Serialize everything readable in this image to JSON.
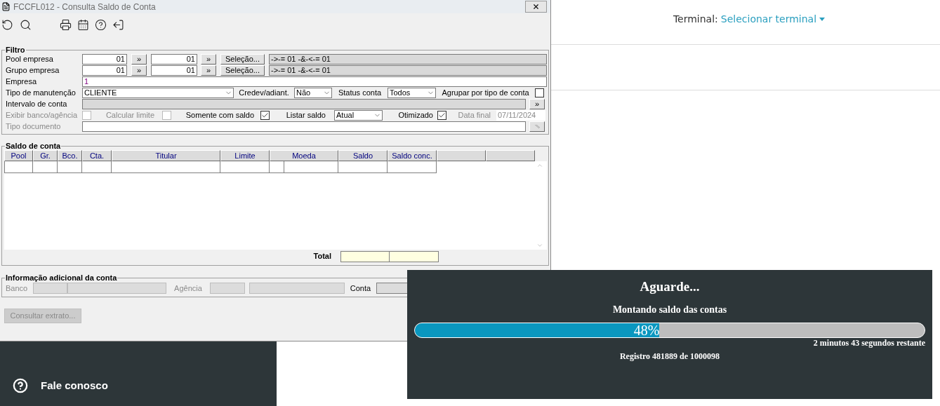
{
  "web_page": {
    "terminal_label": "Terminal:",
    "terminal_value": "Selecionar terminal",
    "sidebar": {
      "items": [
        {
          "label": "Fale conosco"
        }
      ]
    }
  },
  "window": {
    "title": "FCCFL012 - Consulta Saldo de Conta"
  },
  "filtro": {
    "title": "Filtro",
    "range_rows": [
      {
        "label": "Pool empresa",
        "from": "01",
        "from_button": "»",
        "to": "01",
        "to_button": "»",
        "selection_button": "Seleção...",
        "expression": "->-= 01 -&-<-= 01"
      },
      {
        "label": "Grupo empresa",
        "from": "01",
        "from_button": "»",
        "to": "01",
        "to_button": "»",
        "selection_button": "Seleção...",
        "expression": "->-= 01 -&-<-= 01"
      }
    ],
    "empresa": {
      "label": "Empresa",
      "value": "1"
    },
    "tipo_manutencao": {
      "label": "Tipo de manutenção",
      "value": "CLIENTE"
    },
    "credev": {
      "label": "Credev/adiant.",
      "value": "Não"
    },
    "status_conta": {
      "label": "Status conta",
      "value": "Todos"
    },
    "agrupar": {
      "label": "Agrupar por tipo de conta",
      "checked": false
    },
    "intervalo": {
      "label": "Intervalo de conta",
      "button": "»"
    },
    "options": [
      {
        "kind": "checkbox",
        "label": "Exibir banco/agência",
        "checked": false,
        "disabled": true
      },
      {
        "kind": "checkbox",
        "label": "Calcular limite",
        "checked": false,
        "disabled": true
      },
      {
        "kind": "checkbox",
        "label": "Somente com saldo",
        "checked": true,
        "disabled": false
      },
      {
        "kind": "select",
        "label": "Listar saldo",
        "value": "Atual",
        "disabled": false
      },
      {
        "kind": "checkbox",
        "label": "Otimizado",
        "checked": true,
        "disabled": false
      },
      {
        "kind": "date",
        "label": "Data final",
        "value": "07/11/2024",
        "disabled": true
      }
    ],
    "tipo_documento": {
      "label": "Tipo documento",
      "disabled": true
    }
  },
  "saldo": {
    "title": "Saldo de conta",
    "table": {
      "columns": [
        "Pool",
        "Gr.",
        "Bco.",
        "Cta.",
        "Titular",
        "Limite",
        "Moeda",
        "Saldo",
        "Saldo conc."
      ]
    },
    "total_label": "Total"
  },
  "info": {
    "title": "Informação adicional da conta",
    "banco_label": "Banco",
    "agencia_label": "Agência",
    "conta_label": "Conta"
  },
  "consultar_button": {
    "label": "Consultar extrato...",
    "disabled": true
  },
  "progress": {
    "title": "Aguarde...",
    "message": "Montando saldo das contas",
    "level": 0.48,
    "percent": "48%",
    "remaining": "2 minutos 43 segundos restante",
    "record": "Registro 481889 de 1000098"
  }
}
